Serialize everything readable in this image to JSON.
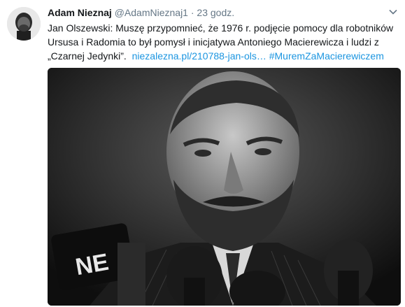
{
  "tweet": {
    "author_name": "Adam Nieznaj",
    "author_handle": "@AdamNieznaj1",
    "separator": "·",
    "time": "23 godz.",
    "text_line1": "Jan Olszewski: Muszę przypomnieć, że 1976 r. podjęcie pomocy dla robotników",
    "text_line2": "Ursusa i Radomia to był pomysł i inicjatywa Antoniego Macierewicza i ludzi z",
    "text_line3": "„Czarnej Jedynki”.",
    "link_text": "niezalezna.pl/210788-jan-ols…",
    "hashtag": "#MuremZaMacierewiczem"
  },
  "icons": {
    "menu": "chevron-down-icon"
  },
  "colors": {
    "text": "#14171a",
    "muted": "#657786",
    "link": "#1b95e0"
  }
}
